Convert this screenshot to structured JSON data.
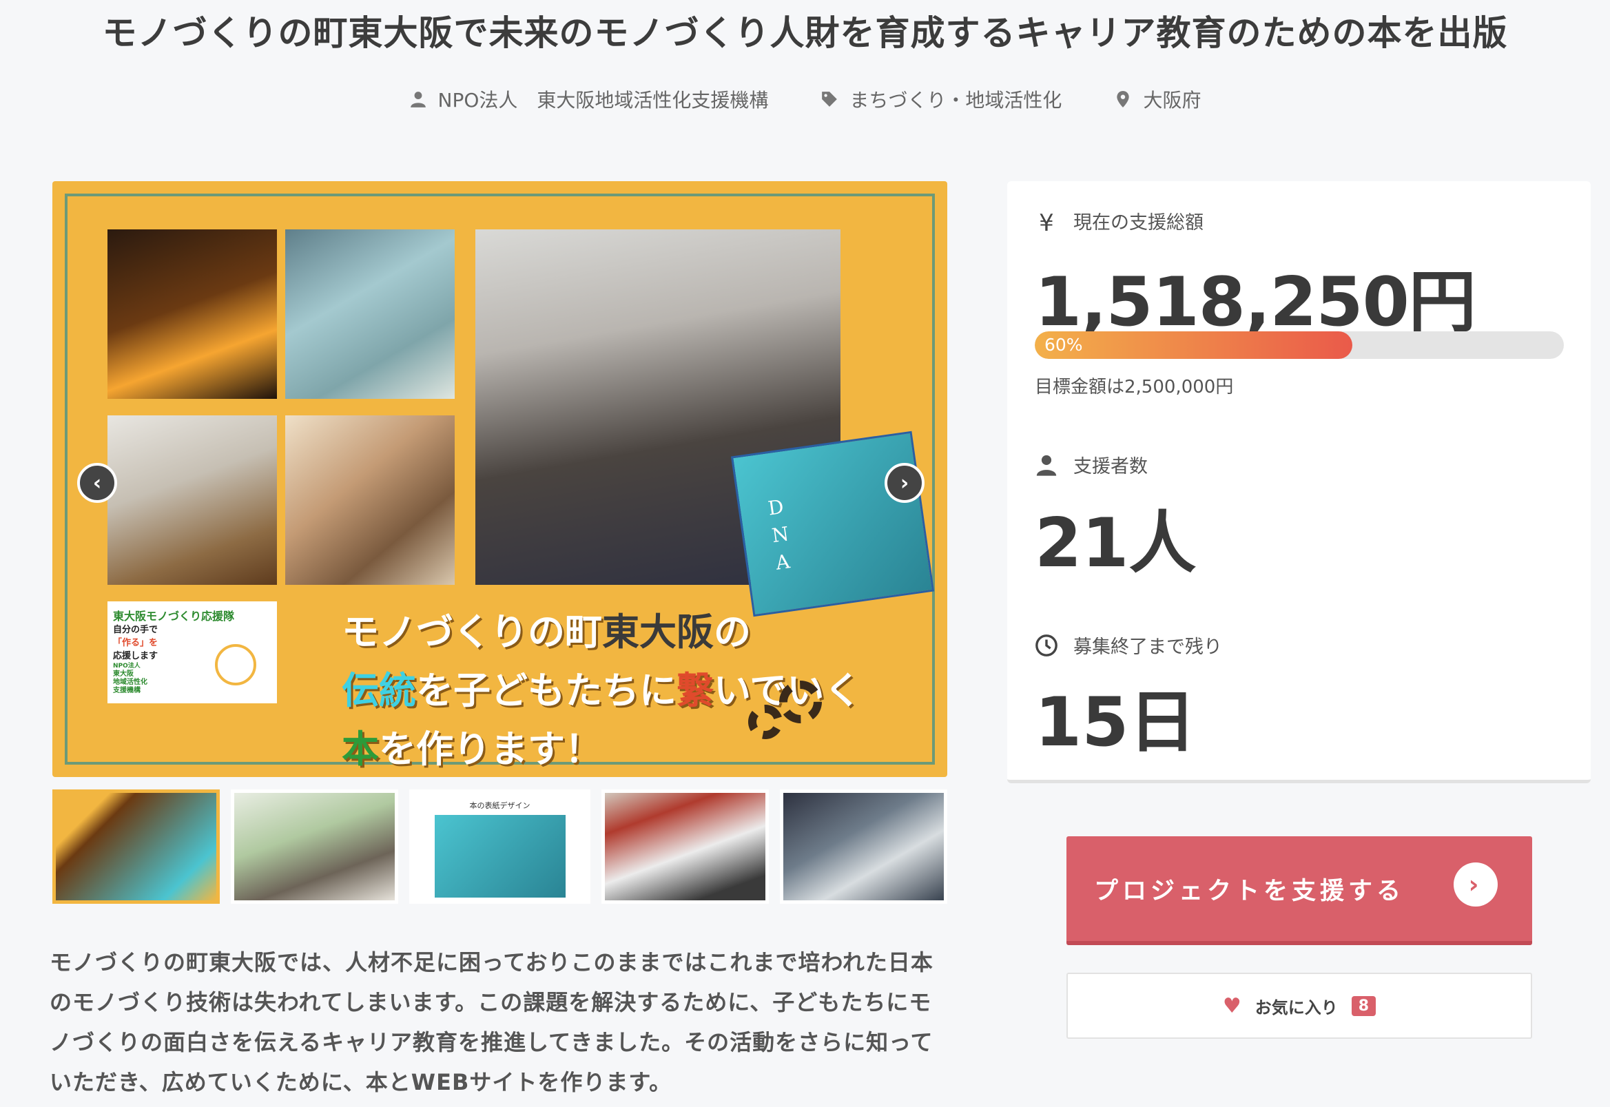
{
  "title": "モノづくりの町東大阪で未来のモノづくり人財を育成するキャリア教育のための本を出版",
  "meta": {
    "organization": "NPO法人　東大阪地域活性化支援機構",
    "category": "まちづくり・地域活性化",
    "location": "大阪府"
  },
  "main_image": {
    "badge_title": "東大阪モノづくり応援隊",
    "badge_line1": "自分の手で",
    "badge_line2": "「作る」を",
    "badge_line3": "応援します",
    "badge_org_1": "NPO法人",
    "badge_org_2": "東大阪",
    "badge_org_3": "地域活性化",
    "badge_org_4": "支援機構",
    "headline_1a": "モノづくりの町",
    "headline_1b": "東大阪",
    "headline_1c": "の",
    "headline_2a": "伝統",
    "headline_2b": "を子どもたちに",
    "headline_2c": "繋",
    "headline_2d": "いでいく",
    "headline_3a": "本",
    "headline_3b": "を作ります！",
    "book_letters": "D\nN\nA",
    "prev_label": "‹",
    "next_label": "›"
  },
  "thumbnails": {
    "t3_caption": "本の表紙デザイン"
  },
  "description": "モノづくりの町東大阪では、人材不足に困っておりこのままではこれまで培われた日本のモノづくり技術は失われてしまいます。この課題を解決するために、子どもたちにモノづくりの面白さを伝えるキャリア教育を推進してきました。その活動をさらに知っていただき、広めていくために、本とWEBサイトを作ります。",
  "stats": {
    "total_label": "現在の支援総額",
    "total_value": "1,518,250円",
    "progress_percent": 60,
    "progress_label": "60%",
    "goal_text": "目標金額は2,500,000円",
    "supporters_label": "支援者数",
    "supporters_value": "21人",
    "remaining_label": "募集終了まで残り",
    "remaining_value": "15日",
    "yen_symbol": "¥"
  },
  "actions": {
    "support_label": "プロジェクトを支援する",
    "support_arrow": "›",
    "favorite_label": "お気に入り",
    "favorite_count": "8",
    "heart": "♥"
  },
  "colors": {
    "accent": "#d9606a",
    "image_bg": "#f2b641",
    "progress_start": "#f3b04a",
    "progress_end": "#ea5a4a"
  }
}
